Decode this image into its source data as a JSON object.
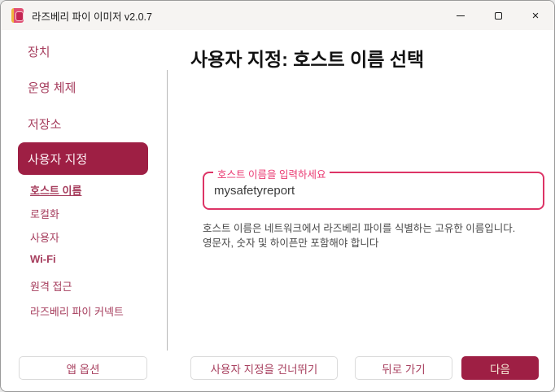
{
  "window": {
    "title": "라즈베리 파이 이미저 v2.0.7",
    "close_glyph": "×"
  },
  "sidebar": {
    "items": [
      {
        "label": "장치"
      },
      {
        "label": "운영 체제"
      },
      {
        "label": "저장소"
      },
      {
        "label": "사용자 지정"
      }
    ],
    "sub_items": [
      {
        "label": "호스트 이름"
      },
      {
        "label": "로컬화"
      },
      {
        "label": "사용자"
      },
      {
        "label": "Wi-Fi"
      },
      {
        "label": "원격 접근"
      },
      {
        "label": "라즈베리 파이 커넥트"
      }
    ]
  },
  "main": {
    "title": "사용자 지정: 호스트 이름 선택",
    "hostname_field": {
      "label": "호스트 이름을 입력하세요",
      "value": "mysafetyreport"
    },
    "helper": {
      "line1": "호스트 이름은 네트워크에서 라즈베리 파이를 식별하는 고유한 이름입니다.",
      "line2": "영문자, 숫자 및 하이픈만 포함해야 합니다"
    }
  },
  "footer": {
    "app_options": "앱 옵션",
    "skip": "사용자 지정을 건너뛰기",
    "back": "뒤로 가기",
    "next": "다음"
  },
  "colors": {
    "accent_dark": "#9e1f44",
    "accent_pink": "#dd3466",
    "sidebar_text": "#a63d5d"
  }
}
